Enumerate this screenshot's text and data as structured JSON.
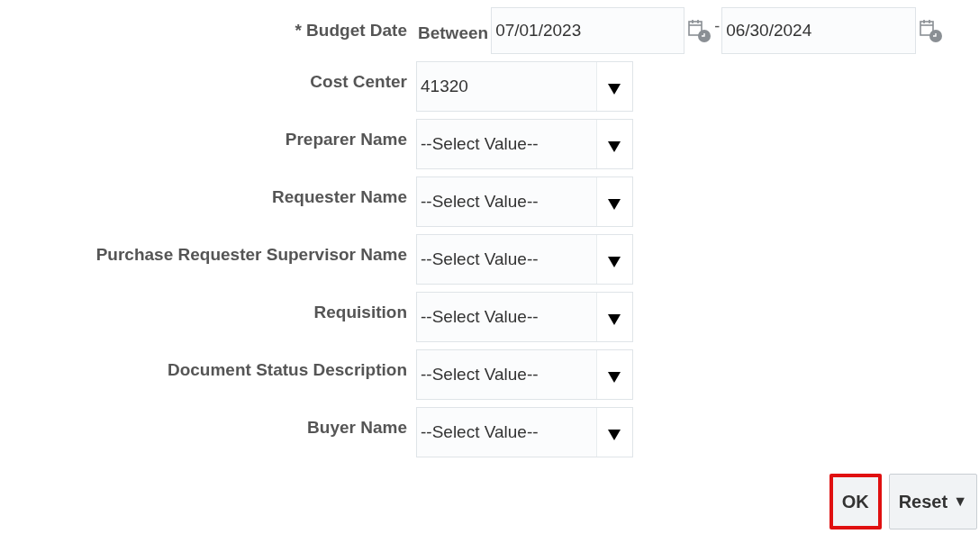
{
  "date_row": {
    "label": "* Budget Date",
    "operator": "Between",
    "from": "07/01/2023",
    "separator": "-",
    "to": "06/30/2024"
  },
  "fields": [
    {
      "label": "Cost Center",
      "value": "41320"
    },
    {
      "label": "Preparer Name",
      "value": "--Select Value--"
    },
    {
      "label": "Requester Name",
      "value": "--Select Value--"
    },
    {
      "label": "Purchase Requester Supervisor Name",
      "value": "--Select Value--"
    },
    {
      "label": "Requisition",
      "value": "--Select Value--"
    },
    {
      "label": "Document Status Description",
      "value": "--Select Value--"
    },
    {
      "label": "Buyer Name",
      "value": "--Select Value--"
    }
  ],
  "buttons": [
    {
      "label": "OK",
      "highlighted": true,
      "menu": false
    },
    {
      "label": "Reset",
      "highlighted": false,
      "menu": true
    }
  ],
  "menu_arrow": "▼"
}
